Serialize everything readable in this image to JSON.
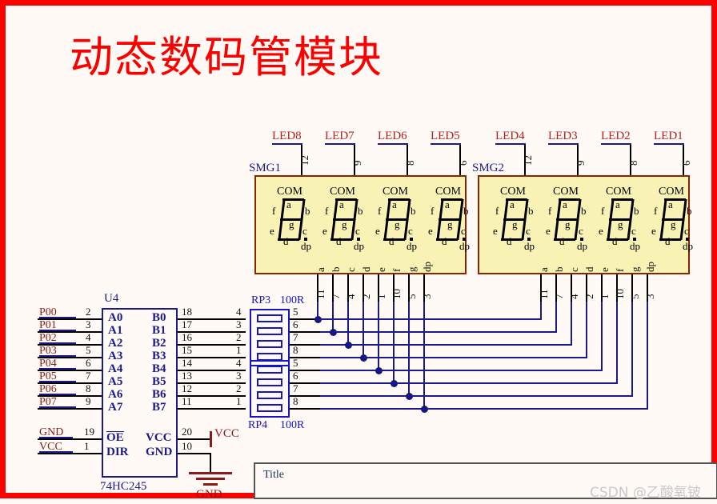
{
  "page": {
    "title": "动态数码管模块",
    "watermark": "CSDN @乙酸氧铍",
    "border_color": "#fe0000",
    "background_color": "#fffaf5"
  },
  "title_block": {
    "label": "Title"
  },
  "displays": [
    {
      "ref": "SMG1",
      "digits": [
        {
          "led_label": "LED8",
          "com_pin": "12",
          "com_text": "COM"
        },
        {
          "led_label": "LED7",
          "com_pin": "9",
          "com_text": "COM"
        },
        {
          "led_label": "LED6",
          "com_pin": "8",
          "com_text": "COM"
        },
        {
          "led_label": "LED5",
          "com_pin": "6",
          "com_text": "COM"
        }
      ],
      "segment_pins": [
        {
          "seg": "a",
          "pin": "11"
        },
        {
          "seg": "b",
          "pin": "7"
        },
        {
          "seg": "c",
          "pin": "4"
        },
        {
          "seg": "d",
          "pin": "2"
        },
        {
          "seg": "e",
          "pin": "1"
        },
        {
          "seg": "f",
          "pin": "10"
        },
        {
          "seg": "g",
          "pin": "5"
        },
        {
          "seg": "dp",
          "pin": "3"
        }
      ]
    },
    {
      "ref": "SMG2",
      "digits": [
        {
          "led_label": "LED4",
          "com_pin": "12",
          "com_text": "COM"
        },
        {
          "led_label": "LED3",
          "com_pin": "9",
          "com_text": "COM"
        },
        {
          "led_label": "LED2",
          "com_pin": "8",
          "com_text": "COM"
        },
        {
          "led_label": "LED1",
          "com_pin": "6",
          "com_text": "COM"
        }
      ],
      "segment_pins": [
        {
          "seg": "a",
          "pin": "11"
        },
        {
          "seg": "b",
          "pin": "7"
        },
        {
          "seg": "c",
          "pin": "4"
        },
        {
          "seg": "d",
          "pin": "2"
        },
        {
          "seg": "e",
          "pin": "1"
        },
        {
          "seg": "f",
          "pin": "10"
        },
        {
          "seg": "g",
          "pin": "5"
        },
        {
          "seg": "dp",
          "pin": "3"
        }
      ]
    }
  ],
  "segment_letters": {
    "a": "a",
    "b": "b",
    "c": "c",
    "d": "d",
    "e": "e",
    "f": "f",
    "g": "g",
    "dp": "dp"
  },
  "ic": {
    "ref": "U4",
    "part": "74HC245",
    "left_pins": [
      {
        "net": "P00",
        "pin": "2",
        "name": "A0"
      },
      {
        "net": "P01",
        "pin": "3",
        "name": "A1"
      },
      {
        "net": "P02",
        "pin": "4",
        "name": "A2"
      },
      {
        "net": "P03",
        "pin": "5",
        "name": "A3"
      },
      {
        "net": "P04",
        "pin": "6",
        "name": "A4"
      },
      {
        "net": "P05",
        "pin": "7",
        "name": "A5"
      },
      {
        "net": "P06",
        "pin": "8",
        "name": "A6"
      },
      {
        "net": "P07",
        "pin": "9",
        "name": "A7"
      }
    ],
    "right_pins": [
      {
        "pin": "18",
        "name": "B0"
      },
      {
        "pin": "17",
        "name": "B1"
      },
      {
        "pin": "16",
        "name": "B2"
      },
      {
        "pin": "15",
        "name": "B3"
      },
      {
        "pin": "14",
        "name": "B4"
      },
      {
        "pin": "13",
        "name": "B5"
      },
      {
        "pin": "12",
        "name": "B6"
      },
      {
        "pin": "11",
        "name": "B7"
      }
    ],
    "power_left": [
      {
        "net": "GND",
        "pin": "19",
        "name": "OE"
      },
      {
        "net": "VCC",
        "pin": "1",
        "name": "DIR"
      }
    ],
    "power_right": [
      {
        "pin": "20",
        "name": "VCC"
      },
      {
        "pin": "10",
        "name": "GND"
      }
    ]
  },
  "resistor_packs": [
    {
      "ref": "RP3",
      "value": "100R",
      "left_pins": [
        "4",
        "3",
        "2",
        "1"
      ],
      "right_pins": [
        "5",
        "6",
        "7",
        "8"
      ]
    },
    {
      "ref": "RP4",
      "value": "100R",
      "left_pins": [
        "4",
        "3",
        "2",
        "1"
      ],
      "right_pins": [
        "5",
        "6",
        "7",
        "8"
      ]
    }
  ],
  "power_symbols": {
    "vcc": "VCC",
    "gnd": "GND"
  }
}
